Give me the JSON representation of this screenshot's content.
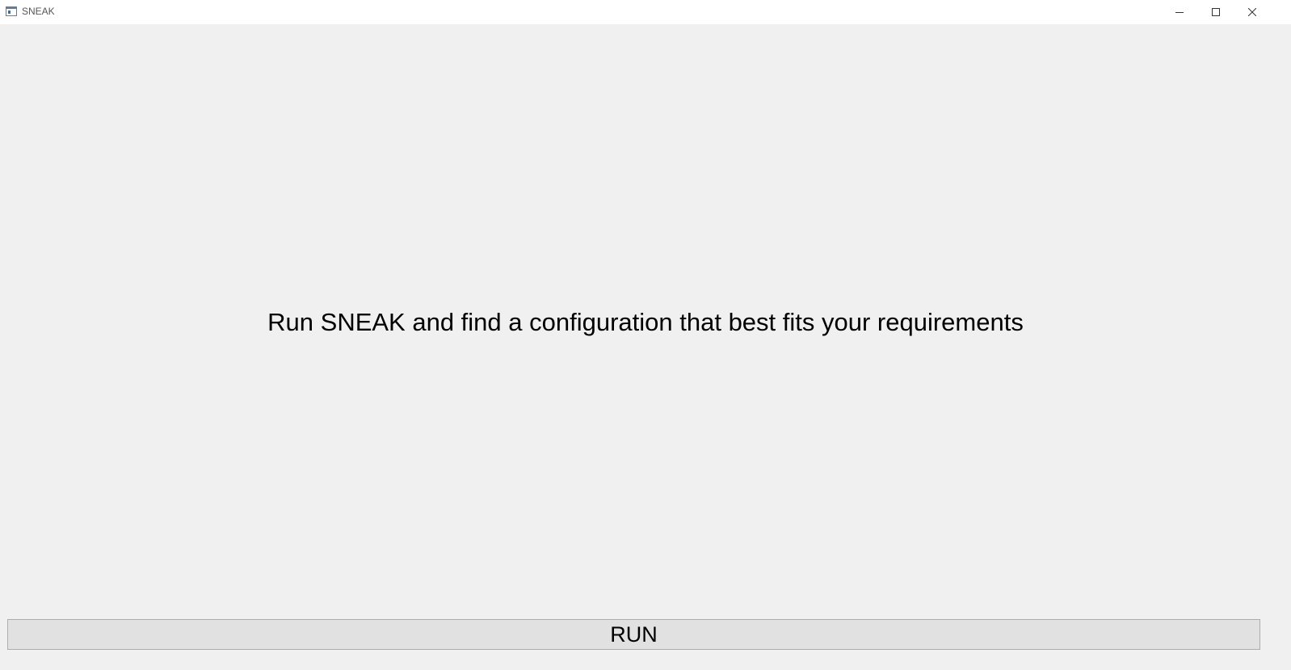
{
  "window": {
    "title": "SNEAK",
    "app_icon": "window-app-icon",
    "controls": {
      "minimize_icon": "minimize-icon",
      "maximize_icon": "maximize-icon",
      "close_icon": "close-icon"
    }
  },
  "main": {
    "prompt_text": "Run SNEAK and find a configuration that best fits your requirements",
    "run_button_label": "RUN"
  },
  "colors": {
    "window_background": "#f0f0f0",
    "titlebar_background": "#ffffff",
    "button_background": "#e1e1e1",
    "button_border": "#adadad"
  }
}
